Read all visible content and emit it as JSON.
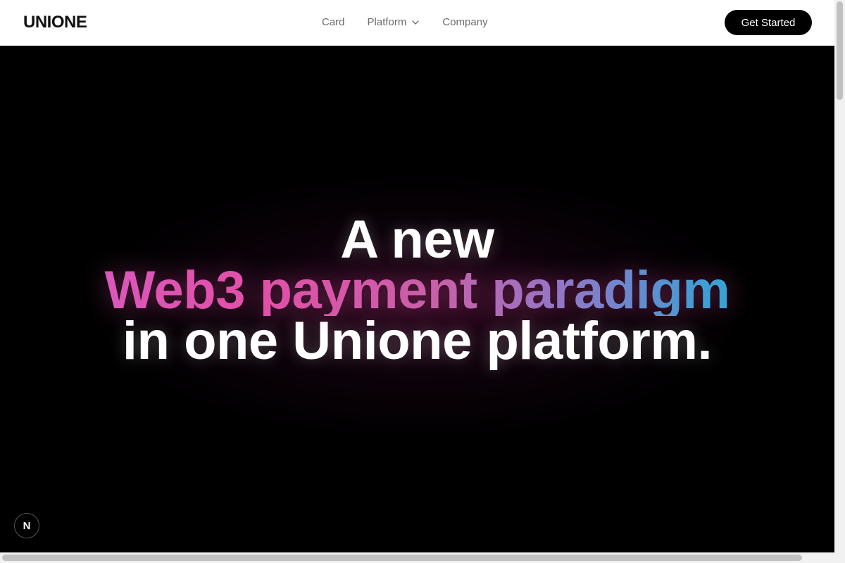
{
  "header": {
    "logo": "UNIONE",
    "nav": [
      {
        "label": "Card"
      },
      {
        "label": "Platform",
        "icon": "chevron-down-icon"
      },
      {
        "label": "Company"
      }
    ],
    "cta_label": "Get Started"
  },
  "hero": {
    "line1": "A new",
    "line2": "Web3 payment paradigm",
    "line3": "in one Unione platform.",
    "gradient_colors": [
      "#d35fc8",
      "#e24fa8",
      "#8f78c8",
      "#19b6d6"
    ],
    "background": "#000000"
  },
  "badge": {
    "label": "N"
  },
  "colors": {
    "accent": "#000000",
    "nav_text": "#6b6b6b"
  }
}
